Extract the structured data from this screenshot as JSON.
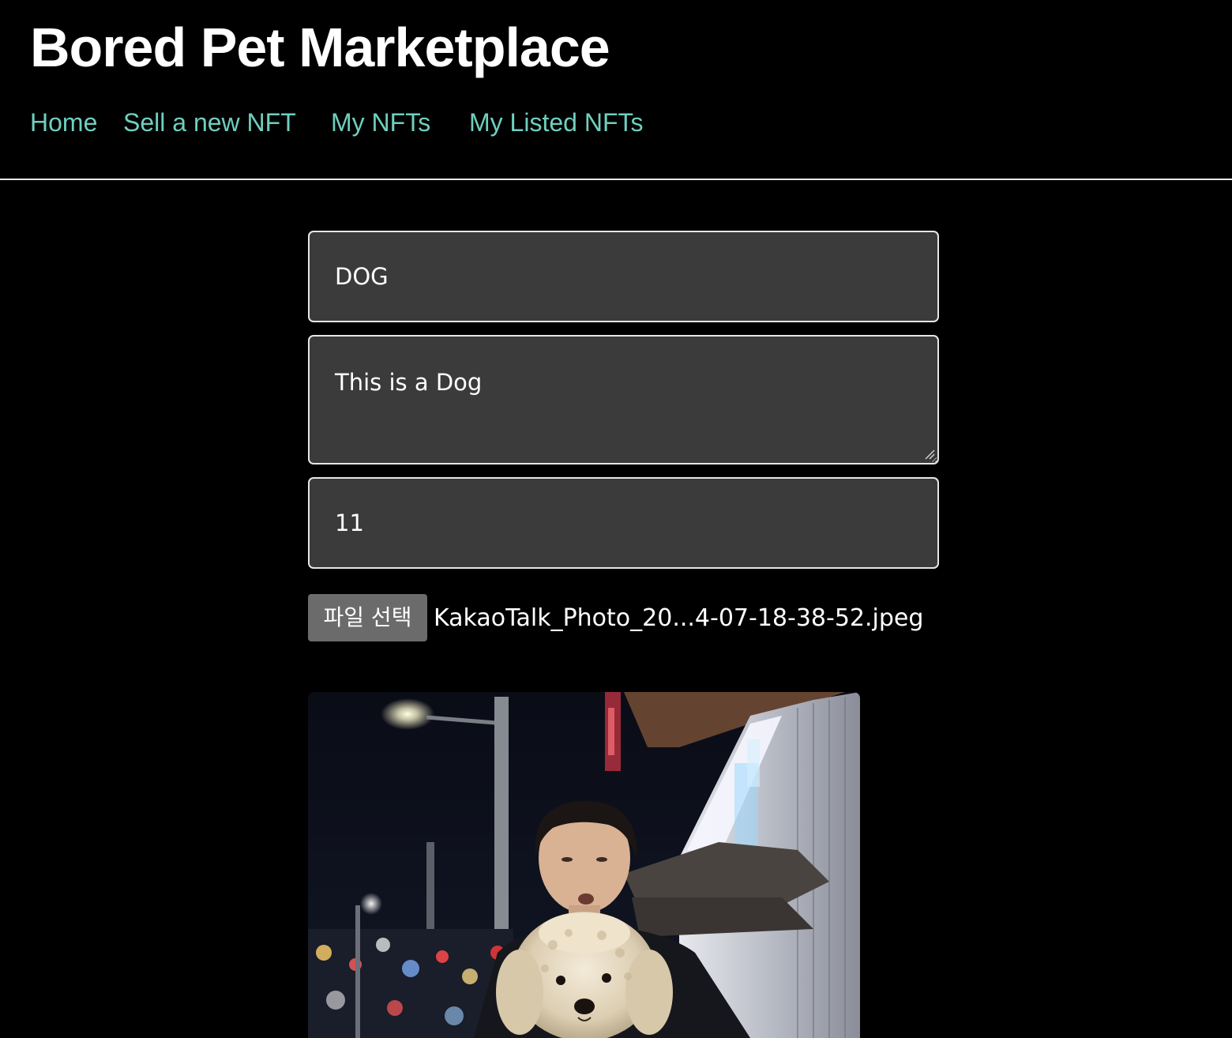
{
  "header": {
    "title": "Bored Pet Marketplace"
  },
  "nav": {
    "items": [
      {
        "label": "Home"
      },
      {
        "label": "Sell a new NFT"
      },
      {
        "label": "My NFTs"
      },
      {
        "label": "My Listed NFTs"
      }
    ]
  },
  "form": {
    "name_value": "DOG",
    "description_value": "This is a Dog",
    "price_value": "11",
    "file_button_label": "파일 선택",
    "file_name": "KakaoTalk_Photo_20...4-07-18-38-52.jpeg"
  },
  "colors": {
    "background": "#000000",
    "nav_link": "#6fcfbf",
    "field_background": "#3b3b3b",
    "field_border": "#e6e6e6",
    "file_button": "#6b6b6b"
  },
  "preview_image": {
    "subject": "person-holding-white-poodle-at-night-street"
  }
}
